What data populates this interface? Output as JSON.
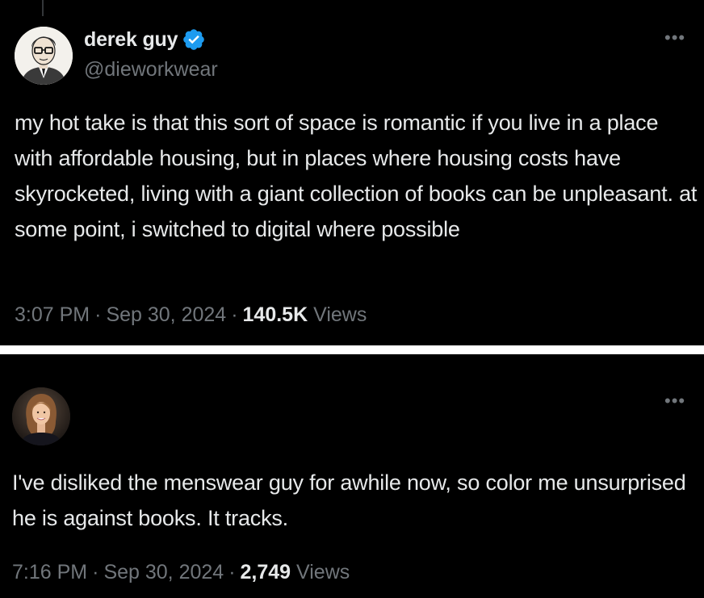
{
  "tweet_primary": {
    "display_name": "derek guy",
    "handle": "@dieworkwear",
    "verified": true,
    "more_icon": "ellipsis-icon",
    "text": "my hot take is that this sort of space is romantic if you live in a place with affordable housing, but in places where housing costs have skyrocketed, living with a giant collection of books can be unpleasant. at some point, i switched to digital where possible",
    "time": "3:07 PM",
    "separator": "·",
    "date": "Sep 30, 2024",
    "views_count": "140.5K",
    "views_label": "Views"
  },
  "tweet_reply": {
    "more_icon": "ellipsis-icon",
    "text": "I've disliked the menswear guy for awhile now, so color me unsurprised he is against books. It tracks.",
    "time": "7:16 PM",
    "separator": "·",
    "date": "Sep 30, 2024",
    "views_count": "2,749",
    "views_label": "Views"
  },
  "colors": {
    "background": "#000000",
    "text_primary": "#e7e9ea",
    "text_secondary": "#71767b",
    "verified_blue": "#1d9bf0",
    "divider": "#ffffff"
  }
}
